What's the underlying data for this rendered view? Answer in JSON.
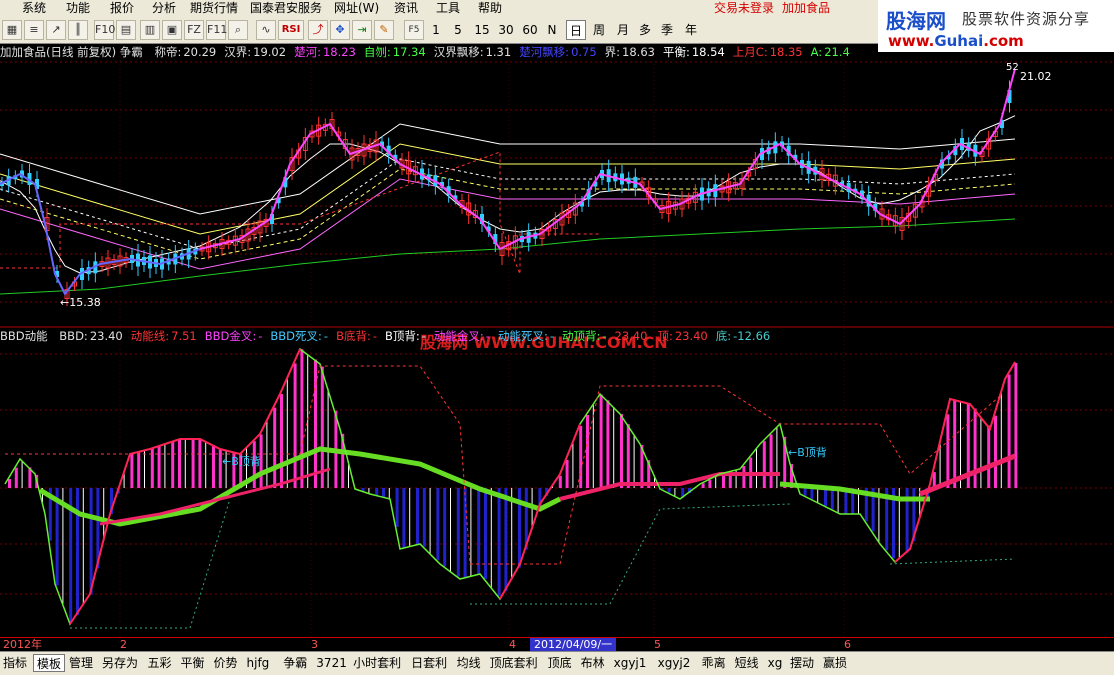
{
  "menubar": {
    "items": [
      "系统",
      "功能",
      "报价",
      "分析",
      "期货行情",
      "国泰君安服务",
      "网址(W)",
      "资讯",
      "工具",
      "帮助"
    ],
    "login_status": "交易未登录",
    "stock_name": "加加食品"
  },
  "brand": {
    "logo": "股海网",
    "slogan": "股票软件资源分享",
    "url_1": "www.",
    "url_2": "Guhai",
    "url_3": ".com"
  },
  "toolbar": {
    "icons": [
      "chart-icon",
      "list-icon",
      "zoom-icon",
      "window-icon",
      "rsi-icon",
      "pointer-icon",
      "move-icon",
      "export-icon",
      "pen-icon"
    ],
    "rsi_label": "RSI",
    "f_labels": [
      "F10",
      "FZ",
      "F11"
    ],
    "period_buttons": [
      "1",
      "5",
      "15",
      "30",
      "60",
      "N",
      "日",
      "周",
      "月",
      "多",
      "季",
      "年"
    ],
    "f5_label": "F5"
  },
  "main_info": {
    "title": "加加食品(日线 前复权) 争霸",
    "items": [
      {
        "label": "称帝:",
        "value": "20.29",
        "color": "#e0e0e0"
      },
      {
        "label": "汉界:",
        "value": "19.02",
        "color": "#e0e0e0"
      },
      {
        "label": "楚河:",
        "value": "18.23",
        "color": "#ff44ff"
      },
      {
        "label": "自刎:",
        "value": "17.34",
        "color": "#44ff44"
      },
      {
        "label": "汉界飘移:",
        "value": "1.31",
        "color": "#e0e0e0"
      },
      {
        "label": "楚河飘移:",
        "value": "0.75",
        "color": "#4444ff"
      },
      {
        "label": "界:",
        "value": "18.63",
        "color": "#e0e0e0"
      },
      {
        "label": "平衡:",
        "value": "18.54",
        "color": "#ffffff"
      },
      {
        "label": "上月C:",
        "value": "18.35",
        "color": "#ff3333"
      },
      {
        "label": "A:",
        "value": "21.4",
        "color": "#44ff44"
      }
    ],
    "price_high": "21.02",
    "price_low": "15.38",
    "right_tag": "52"
  },
  "sub_info": {
    "title": "BBD动能",
    "items": [
      {
        "label": "BBD:",
        "value": "23.40",
        "color": "#e0e0e0"
      },
      {
        "label": "动能线:",
        "value": "7.51",
        "color": "#ff3333"
      },
      {
        "label": "BBD金叉:",
        "value": "-",
        "color": "#ff44ff"
      },
      {
        "label": "BBD死叉:",
        "value": "-",
        "color": "#44ccff"
      },
      {
        "label": "B底背:",
        "value": "-",
        "color": "#ff3333"
      },
      {
        "label": "B顶背:",
        "value": "-",
        "color": "#ffffff"
      },
      {
        "label": "动能金叉:",
        "value": "-",
        "color": "#ff44ff"
      },
      {
        "label": "动能死叉:",
        "value": "-",
        "color": "#44ccff"
      },
      {
        "label": "动顶背:",
        "value": "-",
        "color": "#44ff44"
      },
      {
        "label": "23.40",
        "value": "",
        "color": "#ff3333"
      },
      {
        "label": "顶:",
        "value": "23.40",
        "color": "#ff3333"
      },
      {
        "label": "底:",
        "value": "-12.66",
        "color": "#44cccc"
      }
    ],
    "watermark": "股海网 WWW.GUHAI.COM.CN",
    "marker_1": "B顶背",
    "marker_2": "B顶背"
  },
  "time_axis": {
    "labels": [
      "2012年",
      "2",
      "3",
      "4",
      "2012/04/09/一",
      "5",
      "6"
    ]
  },
  "bottom_tabs": [
    "指标",
    "模板",
    "管理",
    "另存为",
    "五彩",
    "平衡",
    "价势",
    "hjfg",
    "争霸",
    "3721",
    "小时套利",
    "日套利",
    "均线",
    "顶底套利",
    "顶底",
    "布林",
    "xgyj1",
    "xgyj2",
    "乖离",
    "短线",
    "xg",
    "摆动",
    "赢损"
  ],
  "active_tab": "模板"
}
